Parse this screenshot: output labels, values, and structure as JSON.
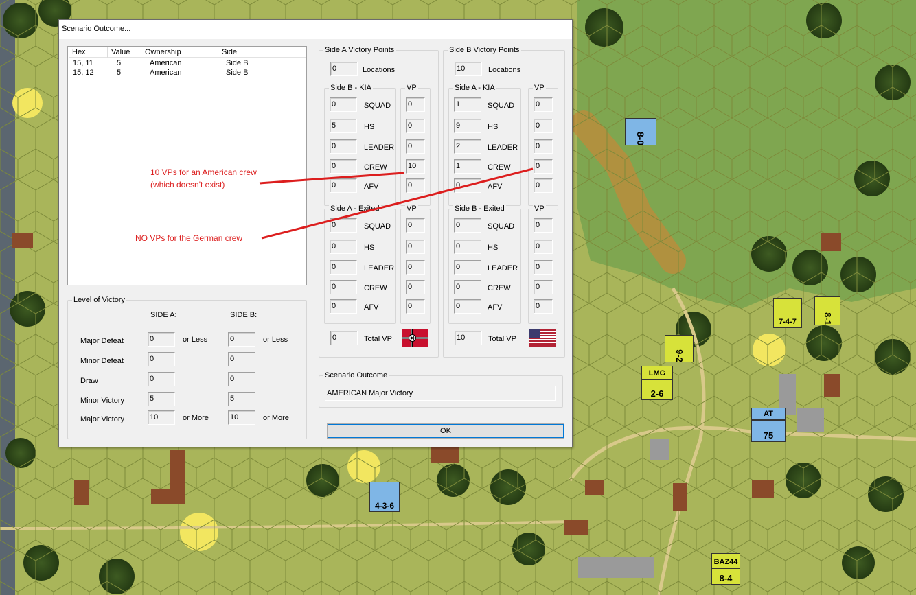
{
  "window_title": "Scenario Outcome...",
  "list": {
    "headers": [
      "Hex",
      "Value",
      "Ownership",
      "Side"
    ],
    "rows": [
      [
        "15, 11",
        "5",
        "American",
        "Side B"
      ],
      [
        "15, 12",
        "5",
        "American",
        "Side B"
      ]
    ]
  },
  "level_of_victory": {
    "title": "Level of Victory",
    "side_a_header": "SIDE A:",
    "side_b_header": "SIDE B:",
    "rows": [
      {
        "label": "Major Defeat",
        "a": "0",
        "a_suffix": "or Less",
        "b": "0",
        "b_suffix": "or Less"
      },
      {
        "label": "Minor Defeat",
        "a": "0",
        "a_suffix": "",
        "b": "0",
        "b_suffix": ""
      },
      {
        "label": "Draw",
        "a": "0",
        "a_suffix": "",
        "b": "0",
        "b_suffix": ""
      },
      {
        "label": "Minor Victory",
        "a": "5",
        "a_suffix": "",
        "b": "5",
        "b_suffix": ""
      },
      {
        "label": "Major Victory",
        "a": "10",
        "a_suffix": "or More",
        "b": "10",
        "b_suffix": "or More"
      }
    ]
  },
  "side_a": {
    "title": "Side A Victory Points",
    "locations_value": "0",
    "locations_label": "Locations",
    "kia_title": "Side B - KIA",
    "vp_title": "VP",
    "kia": [
      {
        "label": "SQUAD",
        "count": "0",
        "vp": "0"
      },
      {
        "label": "HS",
        "count": "5",
        "vp": "0"
      },
      {
        "label": "LEADER",
        "count": "0",
        "vp": "0"
      },
      {
        "label": "CREW",
        "count": "0",
        "vp": "10"
      },
      {
        "label": "AFV",
        "count": "0",
        "vp": "0"
      }
    ],
    "exited_title": "Side A - Exited",
    "exited": [
      {
        "label": "SQUAD",
        "count": "0",
        "vp": "0"
      },
      {
        "label": "HS",
        "count": "0",
        "vp": "0"
      },
      {
        "label": "LEADER",
        "count": "0",
        "vp": "0"
      },
      {
        "label": "CREW",
        "count": "0",
        "vp": "0"
      },
      {
        "label": "AFV",
        "count": "0",
        "vp": "0"
      }
    ],
    "total_value": "0",
    "total_label": "Total VP",
    "flag_icon": "german-war-flag-icon"
  },
  "side_b": {
    "title": "Side B Victory Points",
    "locations_value": "10",
    "locations_label": "Locations",
    "kia_title": "Side A - KIA",
    "vp_title": "VP",
    "kia": [
      {
        "label": "SQUAD",
        "count": "1",
        "vp": "0"
      },
      {
        "label": "HS",
        "count": "9",
        "vp": "0"
      },
      {
        "label": "LEADER",
        "count": "2",
        "vp": "0"
      },
      {
        "label": "CREW",
        "count": "1",
        "vp": "0"
      },
      {
        "label": "AFV",
        "count": "0",
        "vp": "0"
      }
    ],
    "exited_title": "Side B - Exited",
    "exited": [
      {
        "label": "SQUAD",
        "count": "0",
        "vp": "0"
      },
      {
        "label": "HS",
        "count": "0",
        "vp": "0"
      },
      {
        "label": "LEADER",
        "count": "0",
        "vp": "0"
      },
      {
        "label": "CREW",
        "count": "0",
        "vp": "0"
      },
      {
        "label": "AFV",
        "count": "0",
        "vp": "0"
      }
    ],
    "total_value": "10",
    "total_label": "Total VP",
    "flag_icon": "us-flag-icon"
  },
  "outcome": {
    "title": "Scenario Outcome",
    "value": "AMERICAN Major Victory"
  },
  "ok_label": "OK",
  "annotations": {
    "american_crew_line1": "10 VPs for an American crew",
    "american_crew_line2": "(which doesn't exist)",
    "german_crew": "NO VPs for the German crew",
    "color": "#dc1e1e"
  },
  "map_counters": [
    {
      "text": "8-0",
      "color": "#7fb6e6"
    },
    {
      "text": "7-4-7",
      "color": "#d7e23a"
    },
    {
      "text": "8-1",
      "color": "#d7e23a"
    },
    {
      "text": "9-2",
      "color": "#d7e23a"
    },
    {
      "text": "LMG",
      "color": "#d7e23a"
    },
    {
      "text": "2-6",
      "color": "#d7e23a"
    },
    {
      "text": "AT",
      "color": "#7fb6e6"
    },
    {
      "text": "75",
      "color": "#7fb6e6"
    },
    {
      "text": "4-3-6",
      "color": "#7fb6e6"
    },
    {
      "text": "BAZ44",
      "color": "#d7e23a"
    },
    {
      "text": "8-4",
      "color": "#d7e23a"
    }
  ]
}
